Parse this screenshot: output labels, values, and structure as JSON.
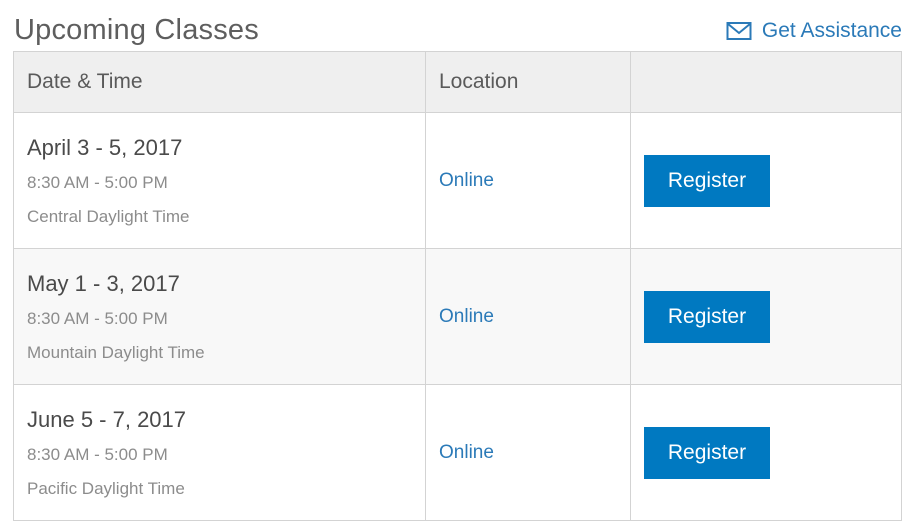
{
  "header": {
    "title": "Upcoming Classes",
    "assistance_label": "Get Assistance",
    "assistance_icon": "envelope-icon"
  },
  "table": {
    "columns": [
      "Date & Time",
      "Location",
      ""
    ],
    "rows": [
      {
        "date": "April 3 - 5, 2017",
        "time": "8:30 AM - 5:00 PM",
        "timezone": "Central Daylight Time",
        "location": "Online",
        "action": "Register"
      },
      {
        "date": "May 1 - 3, 2017",
        "time": "8:30 AM - 5:00 PM",
        "timezone": "Mountain Daylight Time",
        "location": "Online",
        "action": "Register"
      },
      {
        "date": "June 5 - 7, 2017",
        "time": "8:30 AM - 5:00 PM",
        "timezone": "Pacific Daylight Time",
        "location": "Online",
        "action": "Register"
      }
    ]
  },
  "colors": {
    "accent": "#0079c1",
    "link": "#2b7ab8",
    "header_bg": "#efefef",
    "border": "#d3d3d3"
  }
}
